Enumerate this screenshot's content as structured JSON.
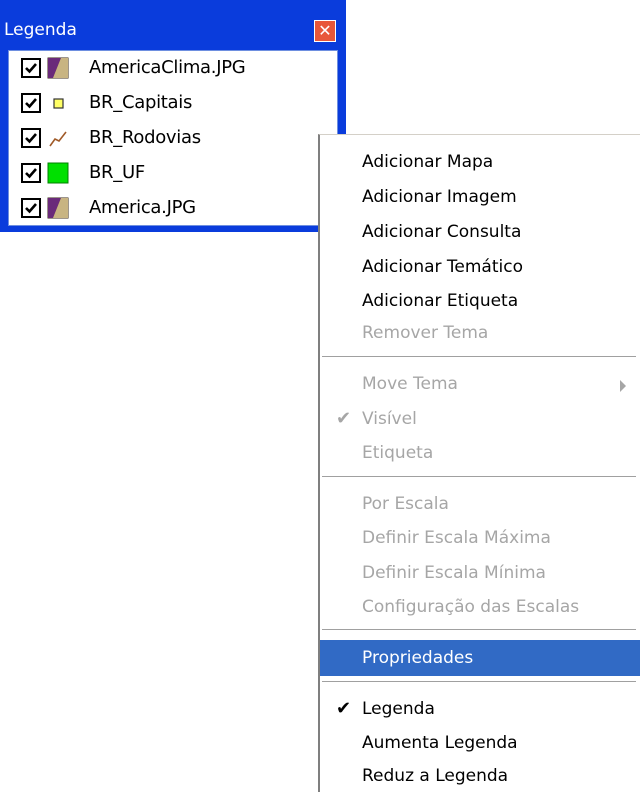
{
  "legend": {
    "title": "Legenda",
    "close_icon": "close-icon",
    "layers": [
      {
        "name": "AmericaClima.JPG",
        "checked": true,
        "icon": "image-layer-icon"
      },
      {
        "name": "BR_Capitais",
        "checked": true,
        "icon": "point-layer-icon"
      },
      {
        "name": "BR_Rodovias",
        "checked": true,
        "icon": "line-layer-icon"
      },
      {
        "name": "BR_UF",
        "checked": true,
        "icon": "polygon-layer-icon"
      },
      {
        "name": "America.JPG",
        "checked": true,
        "icon": "image-layer-icon"
      }
    ]
  },
  "menu": {
    "items": [
      {
        "label": "Adicionar Mapa",
        "enabled": true
      },
      {
        "label": "Adicionar Imagem",
        "enabled": true
      },
      {
        "label": "Adicionar Consulta",
        "enabled": true
      },
      {
        "label": "Adicionar Temático",
        "enabled": true
      },
      {
        "label": "Adicionar Etiqueta",
        "enabled": true
      },
      {
        "label": "Remover Tema",
        "enabled": false
      },
      {
        "label": "Move Tema",
        "enabled": false,
        "submenu": true
      },
      {
        "label": "Visível",
        "enabled": false,
        "checked": true
      },
      {
        "label": "Etiqueta",
        "enabled": false
      },
      {
        "label": "Por Escala",
        "enabled": false
      },
      {
        "label": "Definir Escala Máxima",
        "enabled": false
      },
      {
        "label": "Definir Escala Mínima",
        "enabled": false
      },
      {
        "label": "Configuração das Escalas",
        "enabled": false
      },
      {
        "label": "Propriedades",
        "enabled": true,
        "selected": true
      },
      {
        "label": "Legenda",
        "enabled": true,
        "checked": true
      },
      {
        "label": "Aumenta Legenda",
        "enabled": true
      },
      {
        "label": "Reduz a Legenda",
        "enabled": true
      }
    ],
    "check_glyph": "✔"
  },
  "colors": {
    "title_bar": "#0a3cdc",
    "selection": "#316ac5",
    "disabled_text": "#a6a6a6",
    "polygon_fill": "#00e000",
    "point_fill": "#ffff66"
  }
}
